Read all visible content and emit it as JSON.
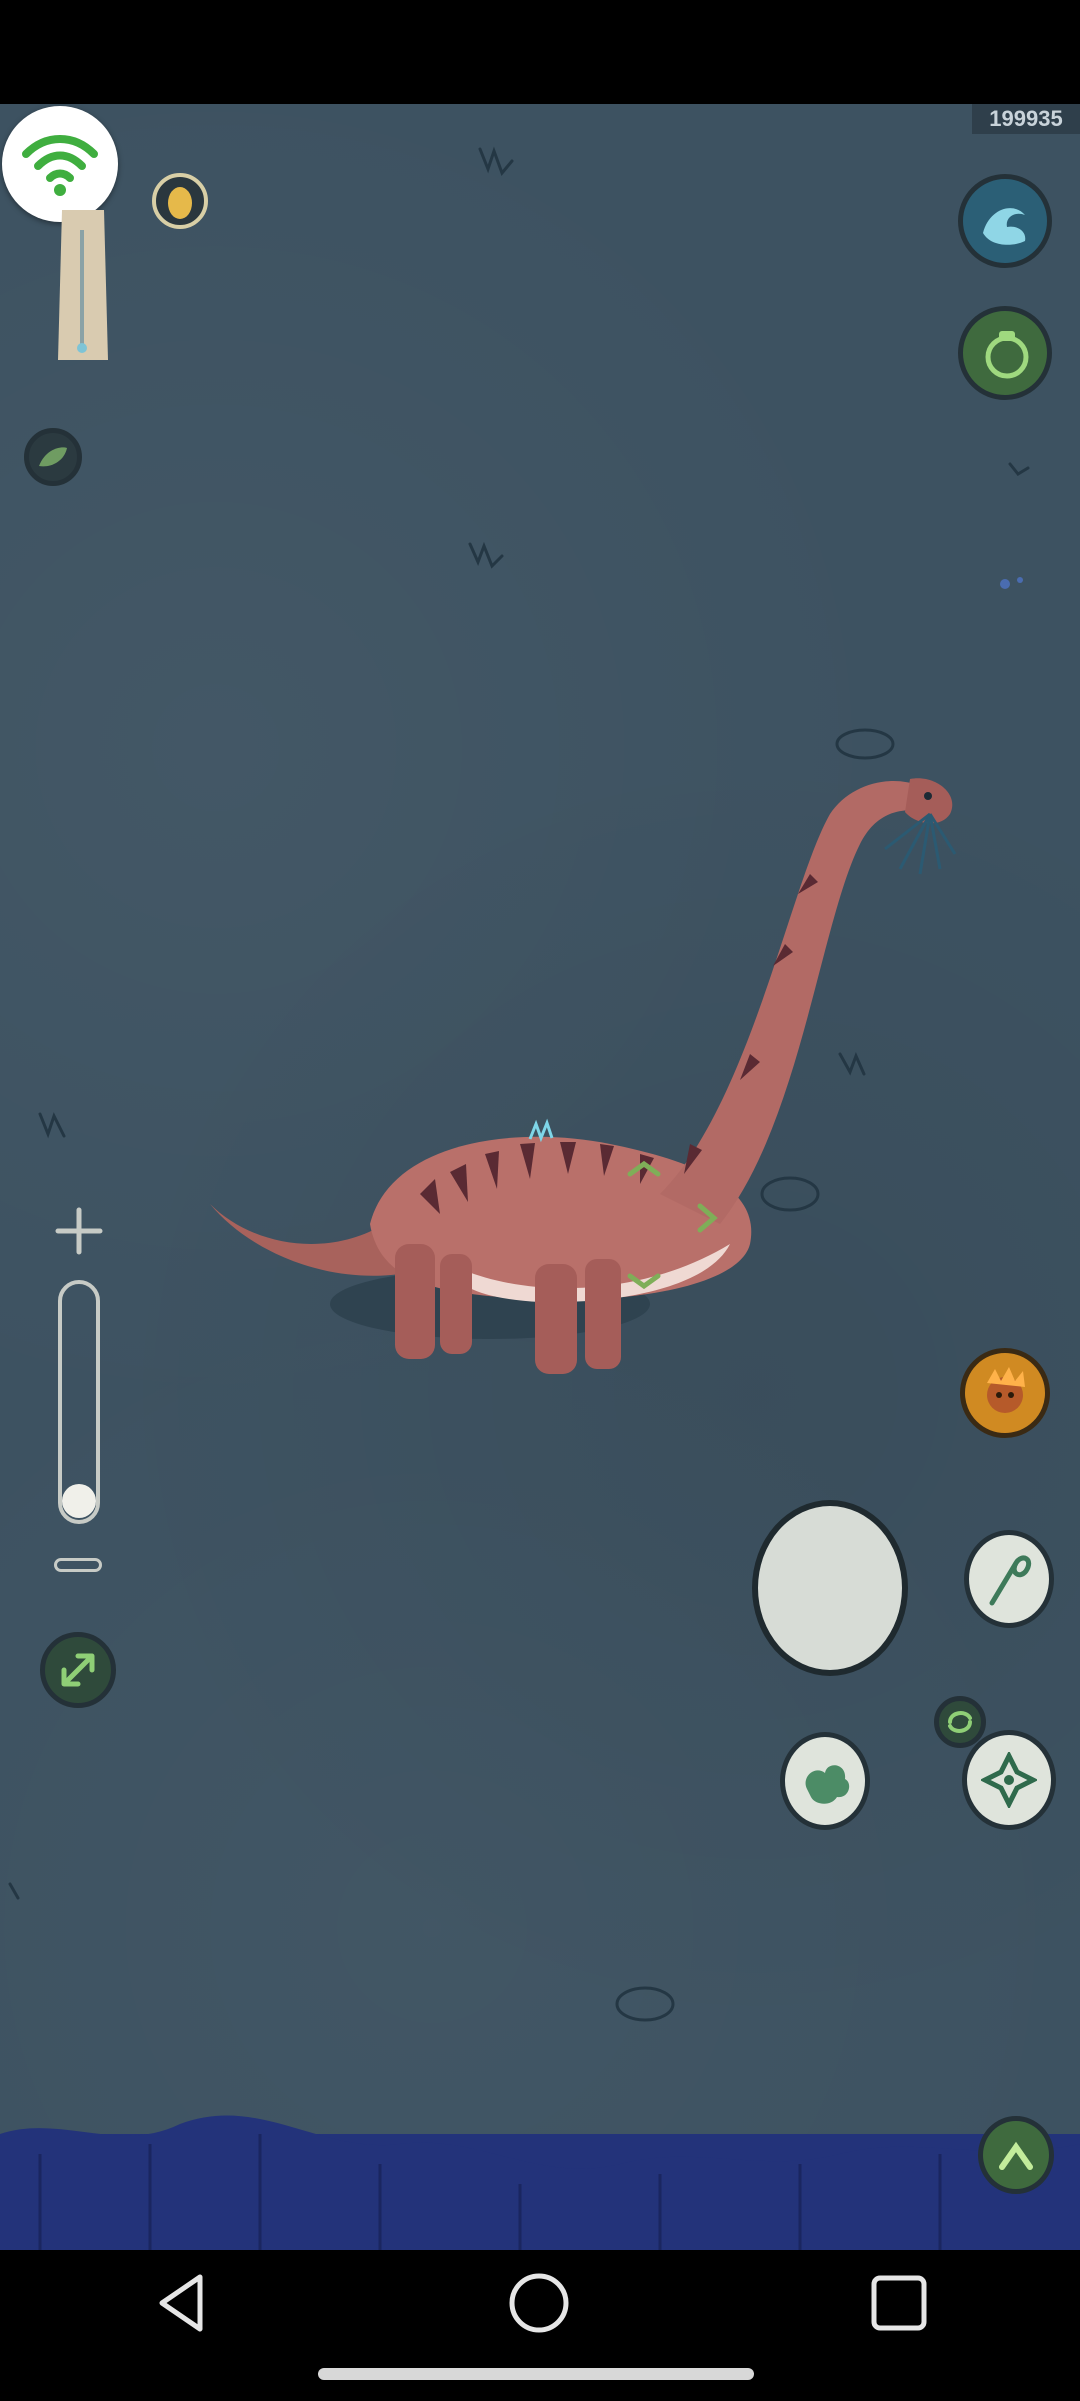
{
  "player": {
    "id": "199935"
  },
  "hud": {
    "wifi": {
      "icon": "wifi-icon",
      "color": "#3fae3f"
    },
    "water_meter_icon": "water-meter-icon",
    "egg_icon": "egg-icon",
    "herb_icon": "leaf-icon",
    "zoom": {
      "plus_icon": "plus-icon",
      "minus_icon": "minus-icon",
      "level": 0.1
    },
    "expand_icon": "expand-arrows-icon",
    "right_column": [
      {
        "name": "water-ability-icon"
      },
      {
        "name": "scent-jar-icon"
      },
      {
        "name": "character-portrait-icon"
      },
      {
        "name": "whip-tail-skill-icon"
      },
      {
        "name": "swap-icon"
      },
      {
        "name": "dust-cloud-skill-icon"
      },
      {
        "name": "compass-star-icon"
      },
      {
        "name": "scroll-up-icon"
      }
    ]
  },
  "colors": {
    "ground": "#3d5261",
    "ui_green": "#5e8c5a",
    "ui_dark": "#243138",
    "water": "#23337a"
  },
  "navbar": {
    "back_icon": "back-triangle-icon",
    "home_icon": "home-circle-icon",
    "recents_icon": "recents-square-icon"
  }
}
